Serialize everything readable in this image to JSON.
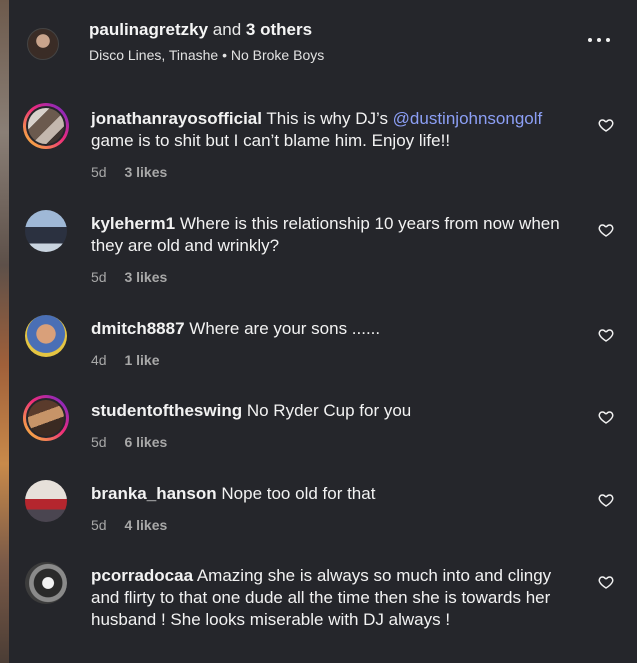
{
  "header": {
    "username": "paulinagretzky",
    "and_text": "and",
    "others": "3 others",
    "subtitle": "Disco Lines, Tinashe • No Broke Boys"
  },
  "comments": [
    {
      "username": "jonathanrayosofficial",
      "text_before": "This is why DJ’s ",
      "mention": "@dustinjohnsongolf",
      "text_after": " game is to shit but I can’t blame him. Enjoy life!!",
      "time": "5d",
      "likes": "3 likes",
      "avatar_ring": true
    },
    {
      "username": "kyleherm1",
      "text": "Where is this relationship 10 years from now when they are old and wrinkly?",
      "time": "5d",
      "likes": "3 likes",
      "avatar_ring": false
    },
    {
      "username": "dmitch8887",
      "text": "Where are your sons ......",
      "time": "4d",
      "likes": "1 like",
      "avatar_ring": false
    },
    {
      "username": "studentoftheswing",
      "text": "No Ryder Cup for you",
      "time": "5d",
      "likes": "6 likes",
      "avatar_ring": true
    },
    {
      "username": "branka_hanson",
      "text": "Nope too old for that",
      "time": "5d",
      "likes": "4 likes",
      "avatar_ring": false
    },
    {
      "username": "pcorradocaa",
      "text": "Amazing she is always so much into and clingy and flirty to that one dude all the time then she is towards her husband ! She looks miserable with DJ always !",
      "time": "",
      "likes": "",
      "avatar_ring": false
    }
  ],
  "colors": {
    "background": "#25262b",
    "mention": "#8c9ff5",
    "meta": "#a8a8a8",
    "story_ring": "#ee2a7b"
  },
  "icons": {
    "header_menu": "more-horizontal-icon",
    "comment_like": "heart-outline-icon"
  }
}
